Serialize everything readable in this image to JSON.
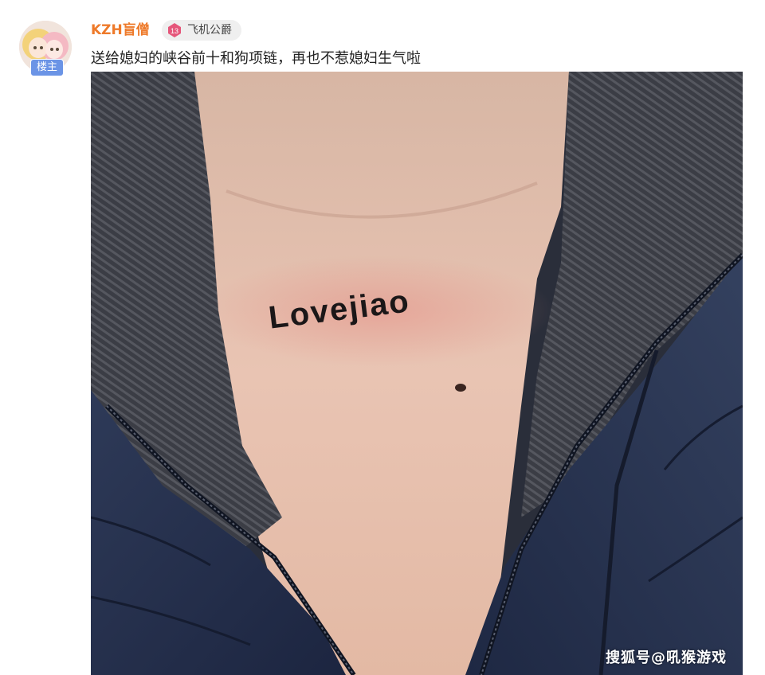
{
  "post": {
    "username": "KZH盲僧",
    "owner_badge": "楼主",
    "fan_badge": {
      "level": "13",
      "name": "飞机公爵"
    },
    "text": "送给媳妇的峡谷前十和狗项链，再也不惹媳妇生气啦",
    "photo": {
      "tattoo_text": "Lovejiao",
      "watermark": "搜狐号@吼猴游戏"
    }
  },
  "colors": {
    "username": "#ee7a2a",
    "owner_badge": "#6b94e6",
    "fan_badge_bg": "#efefef",
    "fan_level": "#e5567a",
    "jacket": "#27324d",
    "skin": "#e7c3b1"
  }
}
